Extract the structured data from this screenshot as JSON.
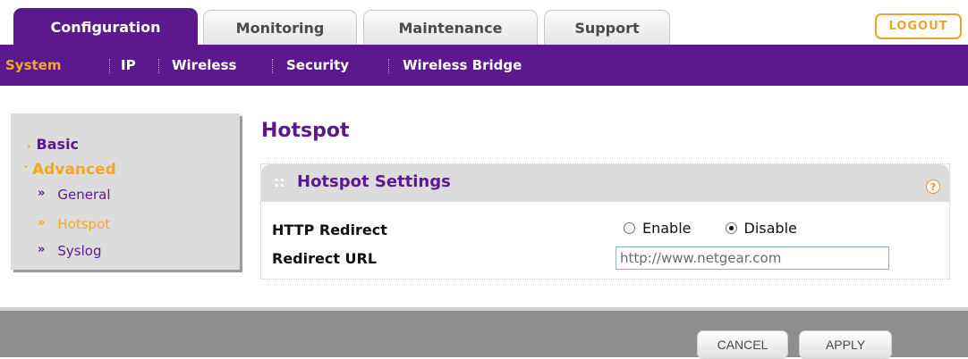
{
  "tabs": [
    {
      "label": "Configuration"
    },
    {
      "label": "Monitoring"
    },
    {
      "label": "Maintenance"
    },
    {
      "label": "Support"
    }
  ],
  "logout_label": "LOGOUT",
  "subnav": [
    {
      "label": "System"
    },
    {
      "label": "IP"
    },
    {
      "label": "Wireless"
    },
    {
      "label": "Security"
    },
    {
      "label": "Wireless Bridge"
    }
  ],
  "leftmenu": {
    "basic": "Basic",
    "advanced": "Advanced",
    "items": [
      {
        "label": "General"
      },
      {
        "label": "Hotspot"
      },
      {
        "label": "Syslog"
      }
    ]
  },
  "page_title": "Hotspot",
  "panel": {
    "title": "Hotspot Settings",
    "help": "?",
    "http_redirect_label": "HTTP Redirect",
    "enable_label": "Enable",
    "disable_label": "Disable",
    "selected": "Disable",
    "redirect_url_label": "Redirect URL",
    "redirect_url_value": "http://www.netgear.com"
  },
  "buttons": {
    "cancel": "CANCEL",
    "apply": "APPLY"
  },
  "colors": {
    "brand_purple": "#5a1a8e",
    "accent_orange": "#f6a623"
  }
}
